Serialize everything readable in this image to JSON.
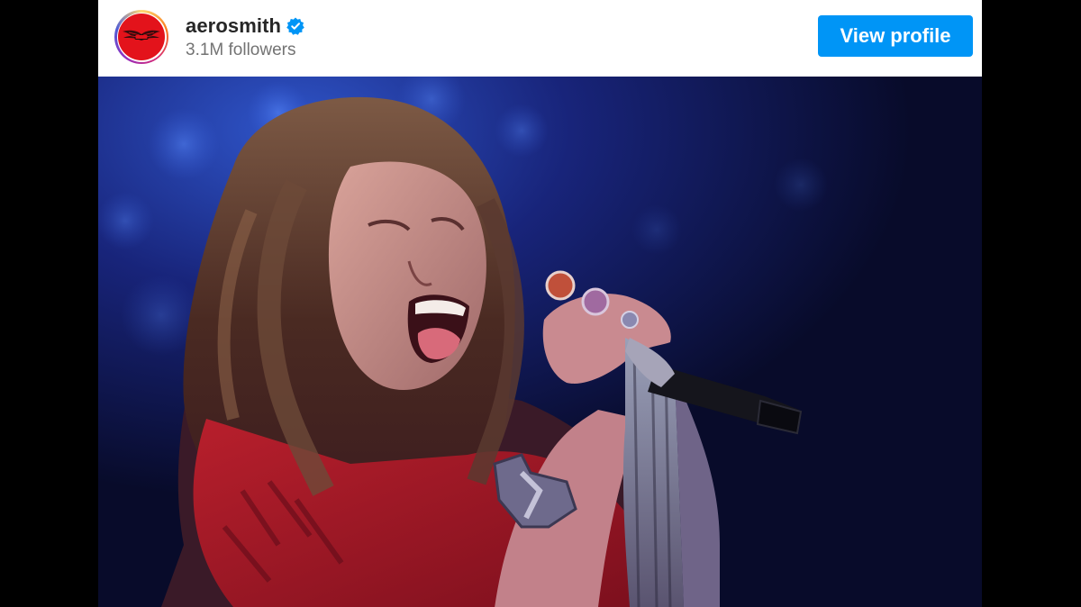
{
  "profile": {
    "username": "aerosmith",
    "verified": true,
    "followers": "3.1M followers",
    "avatar_icon": "aerosmith-wings-logo-icon",
    "avatar_color": "#e3131b"
  },
  "actions": {
    "view_profile_label": "View profile",
    "button_color": "#0095f6"
  },
  "post": {
    "media_icon": "concert-photo-singer-with-microphone"
  }
}
